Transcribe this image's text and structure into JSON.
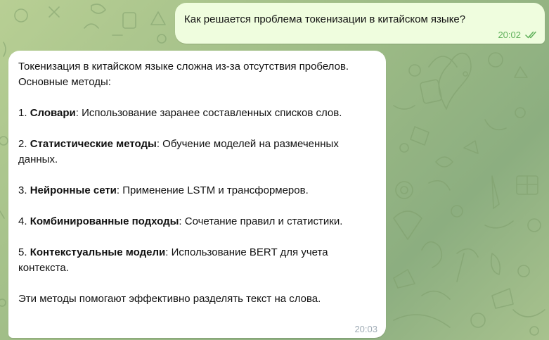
{
  "chat": {
    "outgoing": {
      "text": "Как решается проблема токенизации в китайском языке?",
      "time": "20:02",
      "status_icon": "double-check-icon",
      "status_color": "#5fb05a"
    },
    "incoming": {
      "intro": "Токенизация в китайском языке сложна из-за отсутствия пробелов. Основные методы:",
      "items": [
        {
          "prefix": "1. ",
          "term": "Словари",
          "desc": ": Использование заранее составленных списков слов."
        },
        {
          "prefix": "2. ",
          "term": "Статистические методы",
          "desc": ": Обучение моделей на размеченных данных."
        },
        {
          "prefix": "3. ",
          "term": "Нейронные сети",
          "desc": ": Применение LSTM и трансформеров."
        },
        {
          "prefix": "4. ",
          "term": "Комбинированные подходы",
          "desc": ": Сочетание правил и статистики."
        },
        {
          "prefix": "5. ",
          "term": "Контекстуальные модели",
          "desc": ": Использование BERT для учета контекста."
        }
      ],
      "outro": "Эти методы помогают эффективно разделять текст на слова.",
      "time": "20:03"
    }
  },
  "theme": {
    "outgoing_bubble": "#effdde",
    "incoming_bubble": "#ffffff",
    "wallpaper": "#a4c28b"
  }
}
